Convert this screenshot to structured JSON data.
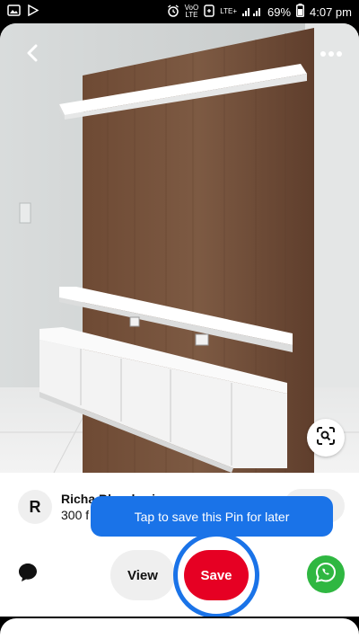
{
  "status_bar": {
    "battery": "69%",
    "time": "4:07 pm",
    "volte_top": "VoO",
    "volte_bottom": "LTE",
    "lte_plus": "LTE+",
    "icons": [
      "gallery-icon",
      "play-store-icon",
      "alarm-icon",
      "volte-icon",
      "data-saver-icon",
      "signal-icon",
      "battery-icon"
    ]
  },
  "pin": {
    "creator_initial": "R",
    "creator_name": "Richa Bhardwaj",
    "creator_followers": "300 f",
    "tooltip": "Tap to save this Pin for later",
    "view_label": "View",
    "save_label": "Save"
  },
  "colors": {
    "save_red": "#e60023",
    "highlight_blue": "#1a73e8",
    "whatsapp_green": "#2fb741",
    "pill_grey": "#efefef"
  }
}
